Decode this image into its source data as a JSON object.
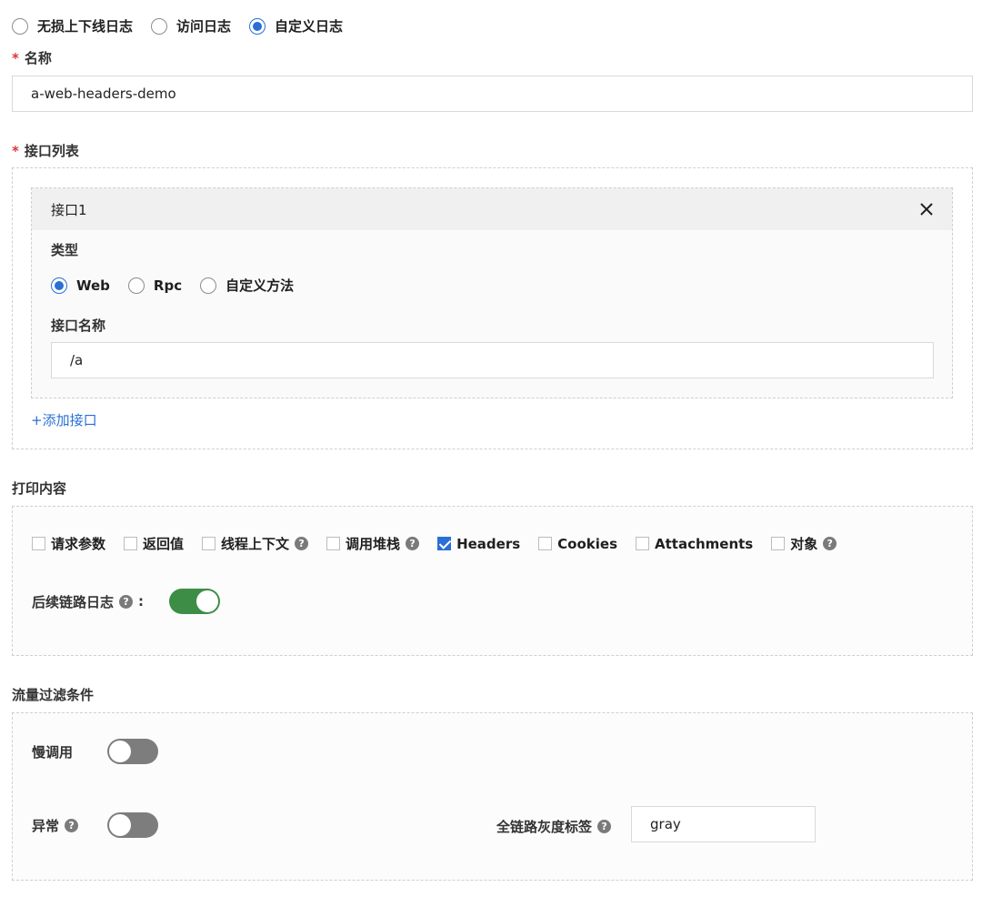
{
  "log_types": {
    "options": [
      {
        "label": "无损上下线日志",
        "selected": false
      },
      {
        "label": "访问日志",
        "selected": false
      },
      {
        "label": "自定义日志",
        "selected": true
      }
    ]
  },
  "name_field": {
    "label": "名称",
    "required_mark": "*",
    "value": "a-web-headers-demo"
  },
  "interface_list": {
    "label": "接口列表",
    "required_mark": "*",
    "card": {
      "title": "接口1",
      "close_icon": "close-icon",
      "type_label": "类型",
      "type_options": [
        {
          "label": "Web",
          "selected": true
        },
        {
          "label": "Rpc",
          "selected": false
        },
        {
          "label": "自定义方法",
          "selected": false
        }
      ],
      "name_label": "接口名称",
      "name_value": "/a"
    },
    "add_link": "+添加接口"
  },
  "print_content": {
    "label": "打印内容",
    "checkboxes": [
      {
        "label": "请求参数",
        "checked": false,
        "help": false
      },
      {
        "label": "返回值",
        "checked": false,
        "help": false
      },
      {
        "label": "线程上下文",
        "checked": false,
        "help": true
      },
      {
        "label": "调用堆栈",
        "checked": false,
        "help": true
      },
      {
        "label": "Headers",
        "checked": true,
        "help": false
      },
      {
        "label": "Cookies",
        "checked": false,
        "help": false
      },
      {
        "label": "Attachments",
        "checked": false,
        "help": false
      },
      {
        "label": "对象",
        "checked": false,
        "help": true
      }
    ],
    "follow_up_label": "后续链路日志",
    "follow_up_colon": ":",
    "follow_up_on": true
  },
  "traffic_filter": {
    "label": "流量过滤条件",
    "slow_call_label": "慢调用",
    "slow_call_on": false,
    "exception_label": "异常",
    "exception_on": false,
    "gray_tag_label": "全链路灰度标签",
    "gray_tag_value": "gray"
  },
  "help_glyph": "?",
  "colors": {
    "accent": "#2a6fd6",
    "toggle_on": "#3e8d46",
    "toggle_off": "#7d7d7d",
    "required": "#d9363e"
  }
}
